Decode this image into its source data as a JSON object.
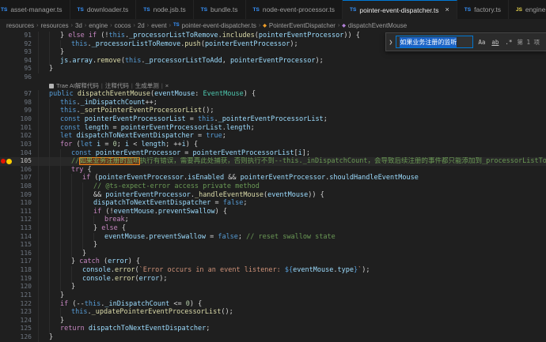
{
  "colors": {
    "accent": "#0078d4",
    "editor_bg": "#1f1f1f",
    "tabbar_bg": "#181818",
    "find_match_border": "#f38518",
    "selection_blue": "#1a63c7",
    "ts_icon": "#3794ff",
    "js_icon": "#e8d44d"
  },
  "tabs": {
    "items": [
      {
        "label": "asset-manager.ts",
        "lang": "ts",
        "active": false
      },
      {
        "label": "downloader.ts",
        "lang": "ts",
        "active": false
      },
      {
        "label": "node.jsb.ts",
        "lang": "ts",
        "active": false
      },
      {
        "label": "bundle.ts",
        "lang": "ts",
        "active": false
      },
      {
        "label": "node-event-processor.ts",
        "lang": "ts",
        "active": false
      },
      {
        "label": "pointer-event-dispatcher.ts",
        "lang": "ts",
        "active": true,
        "close_label": "×"
      },
      {
        "label": "factory.ts",
        "lang": "ts",
        "active": false
      },
      {
        "label": "engine-adapter.js",
        "lang": "js",
        "active": false
      }
    ]
  },
  "breadcrumb": {
    "separator": "›",
    "items": [
      {
        "label": "resources"
      },
      {
        "label": "resources"
      },
      {
        "label": "3d"
      },
      {
        "label": "engine"
      },
      {
        "label": "cocos"
      },
      {
        "label": "2d"
      },
      {
        "label": "event"
      },
      {
        "label": "pointer-event-dispatcher.ts",
        "icon": "ts",
        "icon_text": "TS"
      },
      {
        "label": "PointerEventDispatcher",
        "icon": "class",
        "icon_text": "◆"
      },
      {
        "label": "dispatchEventMouse",
        "icon": "method",
        "icon_text": "◆"
      }
    ]
  },
  "find": {
    "chevron": "❯",
    "query": "如果业务注册的监听",
    "case_label": "Aa",
    "word_label": "ab",
    "regex_label": ".*",
    "result_label": "第 1 项"
  },
  "codelens": {
    "separator": "|",
    "items": [
      "Trae AI解释代码",
      "注释代码",
      "生成单测",
      "×"
    ]
  },
  "editor": {
    "lines": [
      {
        "n": 91,
        "i": 2,
        "t": [
          [
            "f",
            "} "
          ],
          [
            "c",
            "else"
          ],
          [
            "f",
            " "
          ],
          [
            "c",
            "if"
          ],
          [
            "f",
            " (!"
          ],
          [
            "k",
            "this"
          ],
          [
            "f",
            "."
          ],
          [
            "v",
            "_processorListToRemove"
          ],
          [
            "f",
            "."
          ],
          [
            "m",
            "includes"
          ],
          [
            "f",
            "("
          ],
          [
            "v",
            "pointerEventProcessor"
          ],
          [
            "f",
            ")) {"
          ]
        ]
      },
      {
        "n": 92,
        "i": 3,
        "t": [
          [
            "k",
            "this"
          ],
          [
            "f",
            "."
          ],
          [
            "v",
            "_processorListToRemove"
          ],
          [
            "f",
            "."
          ],
          [
            "m",
            "push"
          ],
          [
            "f",
            "("
          ],
          [
            "v",
            "pointerEventProcessor"
          ],
          [
            "f",
            ");"
          ]
        ]
      },
      {
        "n": 93,
        "i": 2,
        "t": [
          [
            "f",
            "}"
          ]
        ]
      },
      {
        "n": 94,
        "i": 2,
        "t": [
          [
            "v",
            "js"
          ],
          [
            "f",
            "."
          ],
          [
            "v",
            "array"
          ],
          [
            "f",
            "."
          ],
          [
            "m",
            "remove"
          ],
          [
            "f",
            "("
          ],
          [
            "k",
            "this"
          ],
          [
            "f",
            "."
          ],
          [
            "v",
            "_processorListToAdd"
          ],
          [
            "f",
            ", "
          ],
          [
            "v",
            "pointerEventProcessor"
          ],
          [
            "f",
            ");"
          ]
        ]
      },
      {
        "n": 95,
        "i": 1,
        "t": [
          [
            "f",
            "}"
          ]
        ]
      },
      {
        "n": 96,
        "i": 0,
        "t": []
      },
      {
        "lens": true
      },
      {
        "n": 97,
        "i": 1,
        "t": [
          [
            "k",
            "public"
          ],
          [
            "f",
            " "
          ],
          [
            "m",
            "dispatchEventMouse"
          ],
          [
            "f",
            "("
          ],
          [
            "v",
            "eventMouse"
          ],
          [
            "f",
            ": "
          ],
          [
            "t",
            "EventMouse"
          ],
          [
            "f",
            ") {"
          ]
        ]
      },
      {
        "n": 98,
        "i": 2,
        "t": [
          [
            "k",
            "this"
          ],
          [
            "f",
            "."
          ],
          [
            "v",
            "_inDispatchCount"
          ],
          [
            "f",
            "++;"
          ]
        ]
      },
      {
        "n": 99,
        "i": 2,
        "t": [
          [
            "k",
            "this"
          ],
          [
            "f",
            "."
          ],
          [
            "m",
            "_sortPointerEventProcessorList"
          ],
          [
            "f",
            "();"
          ]
        ]
      },
      {
        "n": 100,
        "i": 2,
        "t": [
          [
            "k",
            "const"
          ],
          [
            "f",
            " "
          ],
          [
            "v",
            "pointerEventProcessorList"
          ],
          [
            "f",
            " = "
          ],
          [
            "k",
            "this"
          ],
          [
            "f",
            "."
          ],
          [
            "v",
            "_pointerEventProcessorList"
          ],
          [
            "f",
            ";"
          ]
        ]
      },
      {
        "n": 101,
        "i": 2,
        "t": [
          [
            "k",
            "const"
          ],
          [
            "f",
            " "
          ],
          [
            "v",
            "length"
          ],
          [
            "f",
            " = "
          ],
          [
            "v",
            "pointerEventProcessorList"
          ],
          [
            "f",
            "."
          ],
          [
            "v",
            "length"
          ],
          [
            "f",
            ";"
          ]
        ]
      },
      {
        "n": 102,
        "i": 2,
        "t": [
          [
            "k",
            "let"
          ],
          [
            "f",
            " "
          ],
          [
            "v",
            "dispatchToNextEventDispatcher"
          ],
          [
            "f",
            " = "
          ],
          [
            "k",
            "true"
          ],
          [
            "f",
            ";"
          ]
        ]
      },
      {
        "n": 103,
        "i": 2,
        "t": [
          [
            "c",
            "for"
          ],
          [
            "f",
            " ("
          ],
          [
            "k",
            "let"
          ],
          [
            "f",
            " "
          ],
          [
            "v",
            "i"
          ],
          [
            "f",
            " = "
          ],
          [
            "n",
            "0"
          ],
          [
            "f",
            "; "
          ],
          [
            "v",
            "i"
          ],
          [
            "f",
            " < "
          ],
          [
            "v",
            "length"
          ],
          [
            "f",
            "; ++"
          ],
          [
            "v",
            "i"
          ],
          [
            "f",
            ") {"
          ]
        ]
      },
      {
        "n": 104,
        "i": 3,
        "t": [
          [
            "k",
            "const"
          ],
          [
            "f",
            " "
          ],
          [
            "v",
            "pointerEventProcessor"
          ],
          [
            "f",
            " = "
          ],
          [
            "v",
            "pointerEventProcessorList"
          ],
          [
            "f",
            "["
          ],
          [
            "v",
            "i"
          ],
          [
            "f",
            "];"
          ]
        ]
      },
      {
        "n": 105,
        "i": 3,
        "hl": true,
        "bp": true,
        "bulb": true,
        "t": [
          [
            "o",
            "//"
          ],
          [
            "h",
            "如果业务注册的监听"
          ],
          [
            "o",
            "执行有错误，需要再此处捕获，否则执行不到--this._inDispatchCount，会导致后续注册的事件都只能添加到_processorListToAdd"
          ]
        ]
      },
      {
        "n": 106,
        "i": 3,
        "t": [
          [
            "c",
            "try"
          ],
          [
            "f",
            " {"
          ]
        ]
      },
      {
        "n": 107,
        "i": 4,
        "t": [
          [
            "c",
            "if"
          ],
          [
            "f",
            " ("
          ],
          [
            "v",
            "pointerEventProcessor"
          ],
          [
            "f",
            "."
          ],
          [
            "v",
            "isEnabled"
          ],
          [
            "f",
            " && "
          ],
          [
            "v",
            "pointerEventProcessor"
          ],
          [
            "f",
            "."
          ],
          [
            "v",
            "shouldHandleEventMouse"
          ]
        ]
      },
      {
        "n": 108,
        "i": 5,
        "t": [
          [
            "o",
            "// @ts-expect-error access private method"
          ]
        ]
      },
      {
        "n": 109,
        "i": 5,
        "t": [
          [
            "f",
            "&& "
          ],
          [
            "v",
            "pointerEventProcessor"
          ],
          [
            "f",
            "."
          ],
          [
            "m",
            "_handleEventMouse"
          ],
          [
            "f",
            "("
          ],
          [
            "v",
            "eventMouse"
          ],
          [
            "f",
            ")) {"
          ]
        ]
      },
      {
        "n": 110,
        "i": 5,
        "t": [
          [
            "v",
            "dispatchToNextEventDispatcher"
          ],
          [
            "f",
            " = "
          ],
          [
            "k",
            "false"
          ],
          [
            "f",
            ";"
          ]
        ]
      },
      {
        "n": 111,
        "i": 5,
        "t": [
          [
            "c",
            "if"
          ],
          [
            "f",
            " (!"
          ],
          [
            "v",
            "eventMouse"
          ],
          [
            "f",
            "."
          ],
          [
            "v",
            "preventSwallow"
          ],
          [
            "f",
            ") {"
          ]
        ]
      },
      {
        "n": 112,
        "i": 6,
        "t": [
          [
            "c",
            "break"
          ],
          [
            "f",
            ";"
          ]
        ]
      },
      {
        "n": 113,
        "i": 5,
        "t": [
          [
            "f",
            "} "
          ],
          [
            "c",
            "else"
          ],
          [
            "f",
            " {"
          ]
        ]
      },
      {
        "n": 114,
        "i": 6,
        "t": [
          [
            "v",
            "eventMouse"
          ],
          [
            "f",
            "."
          ],
          [
            "v",
            "preventSwallow"
          ],
          [
            "f",
            " = "
          ],
          [
            "k",
            "false"
          ],
          [
            "f",
            "; "
          ],
          [
            "o",
            "// reset swallow state"
          ]
        ]
      },
      {
        "n": 115,
        "i": 5,
        "t": [
          [
            "f",
            "}"
          ]
        ]
      },
      {
        "n": 116,
        "i": 4,
        "t": [
          [
            "f",
            "}"
          ]
        ]
      },
      {
        "n": 117,
        "i": 3,
        "t": [
          [
            "f",
            "} "
          ],
          [
            "c",
            "catch"
          ],
          [
            "f",
            " ("
          ],
          [
            "v",
            "error"
          ],
          [
            "f",
            ") {"
          ]
        ]
      },
      {
        "n": 118,
        "i": 4,
        "t": [
          [
            "v",
            "console"
          ],
          [
            "f",
            "."
          ],
          [
            "m",
            "error"
          ],
          [
            "f",
            "("
          ],
          [
            "s",
            "`Error occurs in an event listener: "
          ],
          [
            "k",
            "${"
          ],
          [
            "v",
            "eventMouse"
          ],
          [
            "f",
            "."
          ],
          [
            "v",
            "type"
          ],
          [
            "k",
            "}"
          ],
          [
            "s",
            "`"
          ],
          [
            "f",
            ");"
          ]
        ]
      },
      {
        "n": 119,
        "i": 4,
        "t": [
          [
            "v",
            "console"
          ],
          [
            "f",
            "."
          ],
          [
            "m",
            "error"
          ],
          [
            "f",
            "("
          ],
          [
            "v",
            "error"
          ],
          [
            "f",
            ");"
          ]
        ]
      },
      {
        "n": 120,
        "i": 3,
        "t": [
          [
            "f",
            "}"
          ]
        ]
      },
      {
        "n": 121,
        "i": 2,
        "t": [
          [
            "f",
            "}"
          ]
        ]
      },
      {
        "n": 122,
        "i": 2,
        "t": [
          [
            "c",
            "if"
          ],
          [
            "f",
            " (--"
          ],
          [
            "k",
            "this"
          ],
          [
            "f",
            "."
          ],
          [
            "v",
            "_inDispatchCount"
          ],
          [
            "f",
            " <= "
          ],
          [
            "n",
            "0"
          ],
          [
            "f",
            ") {"
          ]
        ]
      },
      {
        "n": 123,
        "i": 3,
        "t": [
          [
            "k",
            "this"
          ],
          [
            "f",
            "."
          ],
          [
            "m",
            "_updatePointerEventProcessorList"
          ],
          [
            "f",
            "();"
          ]
        ]
      },
      {
        "n": 124,
        "i": 2,
        "t": [
          [
            "f",
            "}"
          ]
        ]
      },
      {
        "n": 125,
        "i": 2,
        "t": [
          [
            "c",
            "return"
          ],
          [
            "f",
            " "
          ],
          [
            "v",
            "dispatchToNextEventDispatcher"
          ],
          [
            "f",
            ";"
          ]
        ]
      },
      {
        "n": 126,
        "i": 1,
        "t": [
          [
            "f",
            "}"
          ]
        ]
      }
    ]
  }
}
